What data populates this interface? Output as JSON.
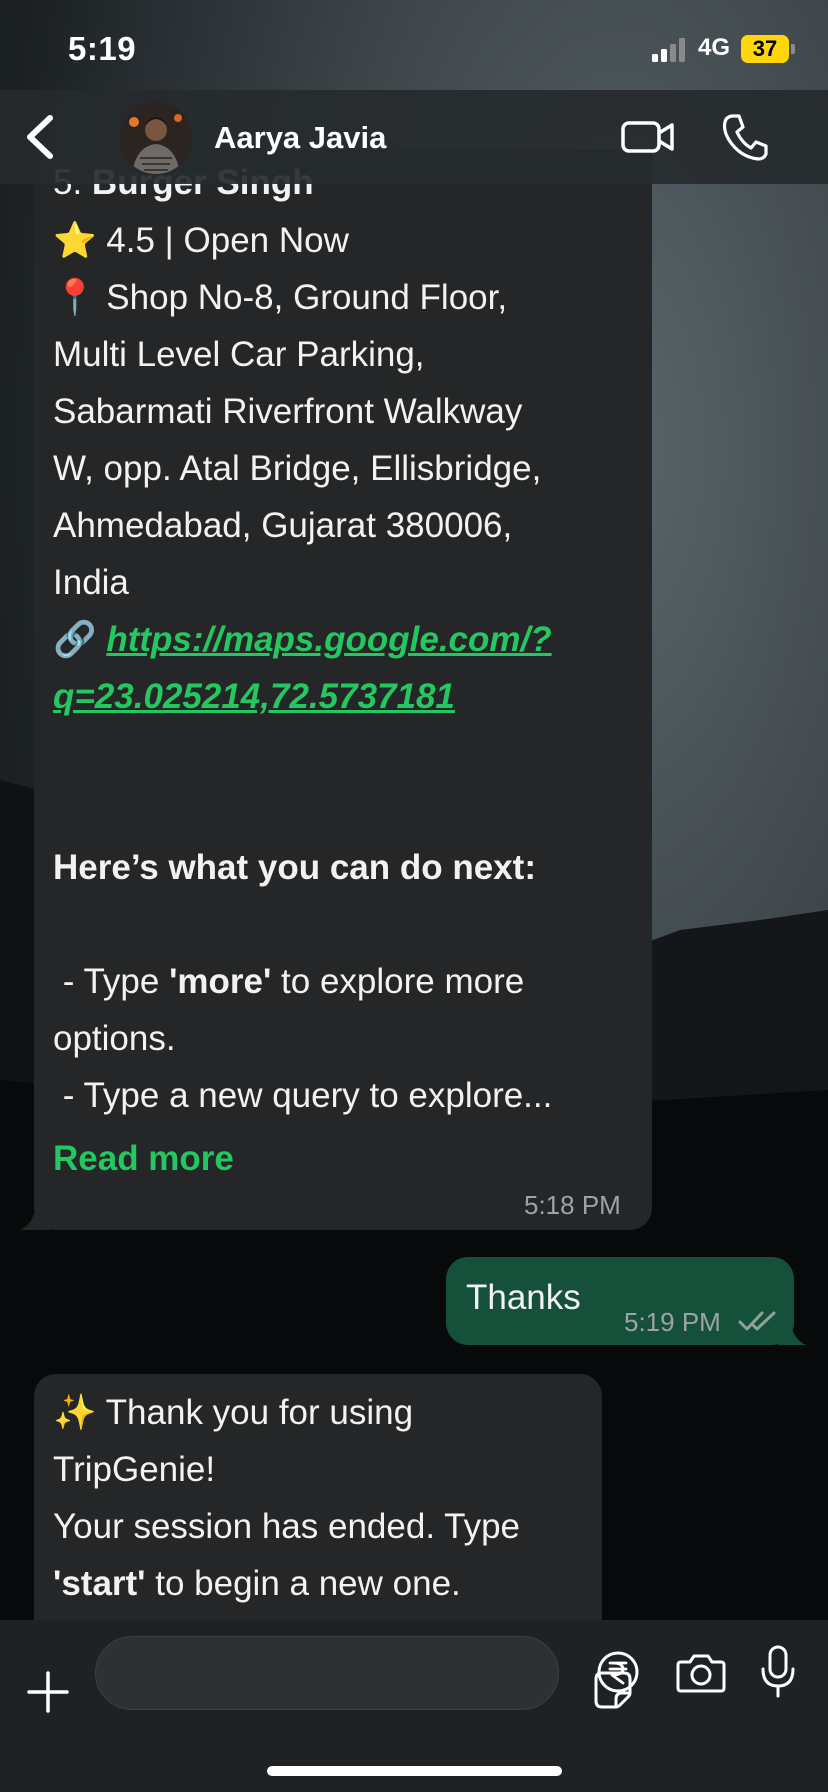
{
  "status_bar": {
    "time": "5:19",
    "network": "4G",
    "battery": "37"
  },
  "header": {
    "contact_name": "Aarya Javia"
  },
  "messages": [
    {
      "title_prefix": "5. ",
      "title": "Burger Singh",
      "rating_line": "⭐ 4.5 | Open Now",
      "address_lines": [
        "📍 Shop No-8, Ground Floor,",
        "Multi Level Car Parking,",
        "Sabarmati Riverfront Walkway",
        "W, opp. Atal Bridge, Ellisbridge,",
        "Ahmedabad, Gujarat 380006,",
        "India"
      ],
      "link_icon": "🔗",
      "link_line1": "https://maps.google.com/?",
      "link_line2": "q=23.025214,72.5737181",
      "next_heading": "Here’s what you can do next:",
      "option1_prefix": " - Type ",
      "option1_keyword": "'more'",
      "option1_suffix": " to explore more",
      "option1_cont": "options.",
      "option2": " - Type a new query to explore...",
      "read_more": "Read more",
      "time": "5:18 PM"
    },
    {
      "text": "Thanks",
      "time": "5:19 PM"
    },
    {
      "line1": "✨ Thank you for using",
      "line2": "TripGenie!",
      "line3": "Your session has ended. Type",
      "line4_keyword": "'start'",
      "line4_suffix": " to begin a new one."
    }
  ],
  "compose": {
    "placeholder": ""
  },
  "colors": {
    "accent": "#25c760",
    "outgoing": "#15503b",
    "incoming": "#242627"
  }
}
